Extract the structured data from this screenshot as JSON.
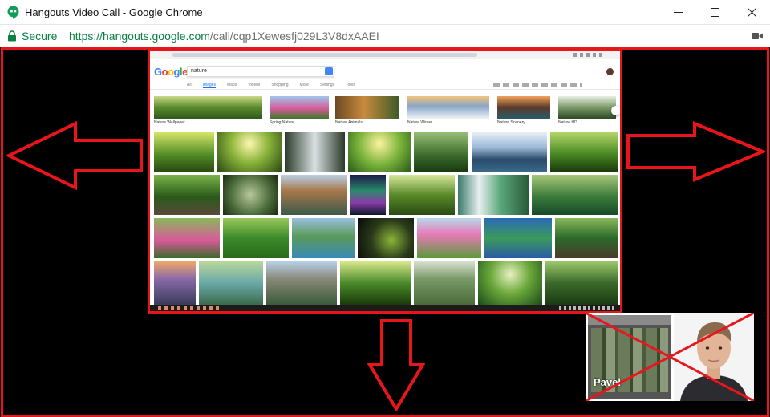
{
  "window": {
    "title": "Hangouts Video Call - Google Chrome",
    "minimize_label": "Minimize",
    "maximize_label": "Maximize",
    "close_label": "Close"
  },
  "address_bar": {
    "security_label": "Secure",
    "url_scheme_host": "https://hangouts.google.com",
    "url_path": "/call/cqp1Xewesfj029L3V8dxAAEI"
  },
  "shared_screen": {
    "search_query": "nature",
    "tabs": [
      "All",
      "Images",
      "Maps",
      "Videos",
      "Shopping",
      "More",
      "Settings",
      "Tools"
    ],
    "active_tab_index": 1,
    "related_chips": [
      "Nature Wallpaper",
      "Spring Nature",
      "Nature Animals",
      "Nature Winter",
      "Nature Scenery",
      "Nature HD"
    ]
  },
  "self_view": {
    "name_label": "Pavel"
  },
  "colors": {
    "annotation_red": "#e8161b",
    "secure_green": "#0b8043"
  },
  "icons": [
    "hangouts-icon",
    "minimize-icon",
    "maximize-icon",
    "close-icon",
    "lock-icon",
    "video-camera-icon",
    "arrow-left-icon",
    "arrow-right-icon",
    "arrow-down-icon"
  ]
}
